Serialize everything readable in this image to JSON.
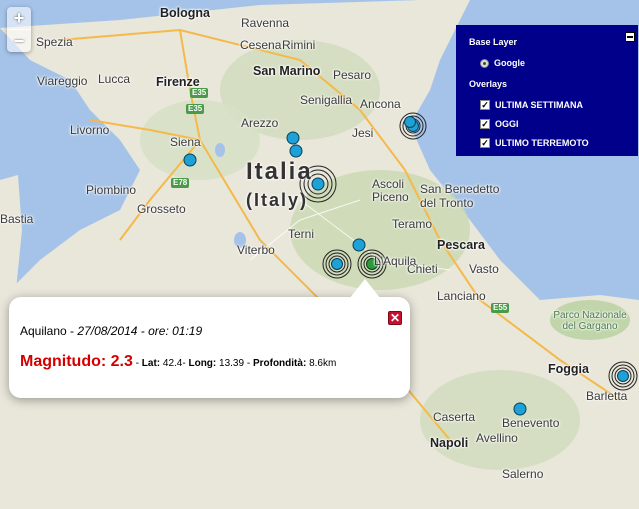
{
  "places": {
    "bologna": "Bologna",
    "ravenna": "Ravenna",
    "cesena": "Cesena",
    "rimini": "Rimini",
    "sanmarino": "San Marino",
    "pesaro": "Pesaro",
    "senigallia": "Senigallia",
    "ancona": "Ancona",
    "jesi": "Jesi",
    "spezia": "Spezia",
    "viareggio": "Viareggio",
    "lucca": "Lucca",
    "firenze": "Firenze",
    "livorno": "Livorno",
    "arezzo": "Arezzo",
    "siena": "Siena",
    "piombino": "Piombino",
    "grosseto": "Grosseto",
    "ascoli": "Ascoli\nPiceno",
    "sanbenedetto": "San Benedetto\ndel Tronto",
    "teramo": "Teramo",
    "terni": "Terni",
    "viterbo": "Viterbo",
    "pescara": "Pescara",
    "chieti": "Chieti",
    "lanciano": "Lanciano",
    "vasto": "Vasto",
    "foggia": "Foggia",
    "barletta": "Barletta",
    "caserta": "Caserta",
    "napoli": "Napoli",
    "avellino": "Avellino",
    "benevento": "Benevento",
    "salerno": "Salerno",
    "bastia": "Bastia",
    "laquila": "L'Aquila",
    "gargano": "Parco Nazionale del Gargano"
  },
  "country": {
    "name": "Italia",
    "name_en": "(Italy)"
  },
  "roads": {
    "e35a": "E35",
    "e35b": "E35",
    "e78": "E78",
    "e55": "E55"
  },
  "zoom": {
    "in": "+",
    "out": "−"
  },
  "layers": {
    "base_title": "Base Layer",
    "base_option": "Google",
    "overlays_title": "Overlays",
    "overlays": [
      {
        "label": "ULTIMA SETTIMANA",
        "checked": true
      },
      {
        "label": "OGGI",
        "checked": true
      },
      {
        "label": "ULTIMO TERREMOTO",
        "checked": true
      }
    ]
  },
  "popup": {
    "location": "Aquilano",
    "separator": " - ",
    "datetime": "27/08/2014 - ore: 01:19",
    "mag_label": "Magnitudo: 2.3",
    "lat_label": "Lat:",
    "lat": "42.4-",
    "long_label": "Long:",
    "long": "13.39",
    "depth_label": "Profondità:",
    "depth": "8.6km",
    "close": "✕"
  },
  "colors": {
    "marker": "#1ea1d6",
    "marker_latest": "#2a9a3a",
    "sea": "#a5c3e8",
    "land": "#e8e4d8",
    "panel": "#00008b"
  }
}
